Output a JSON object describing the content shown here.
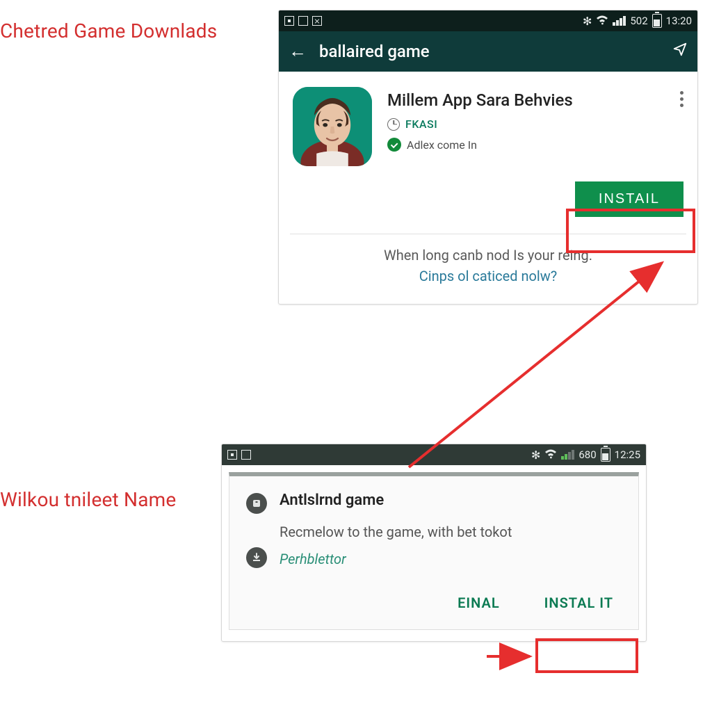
{
  "captions": {
    "top": "Chetred Game Downlads",
    "bottom": "Wilkou tnileet Name"
  },
  "phone_a": {
    "status": {
      "num": "502",
      "time": "13:20"
    },
    "appbar": {
      "title": "ballaired game"
    },
    "app": {
      "title": "Millem App Sara Behvies",
      "tag": "FKASI",
      "verified_text": "Adlex come In"
    },
    "install_label": "INSTAIL",
    "footer": {
      "line1": "When long canb nod Is your reing.",
      "line2": "Cinps ol caticed nolw?"
    }
  },
  "phone_b": {
    "status": {
      "num": "680",
      "time": "12:25"
    },
    "dialog": {
      "title": "Antlslrnd game",
      "body": "Recmelow to the game, with bet tokot",
      "sub": "Perhblettor",
      "action_left": "EINAL",
      "action_right": "INSTAL IT"
    }
  }
}
